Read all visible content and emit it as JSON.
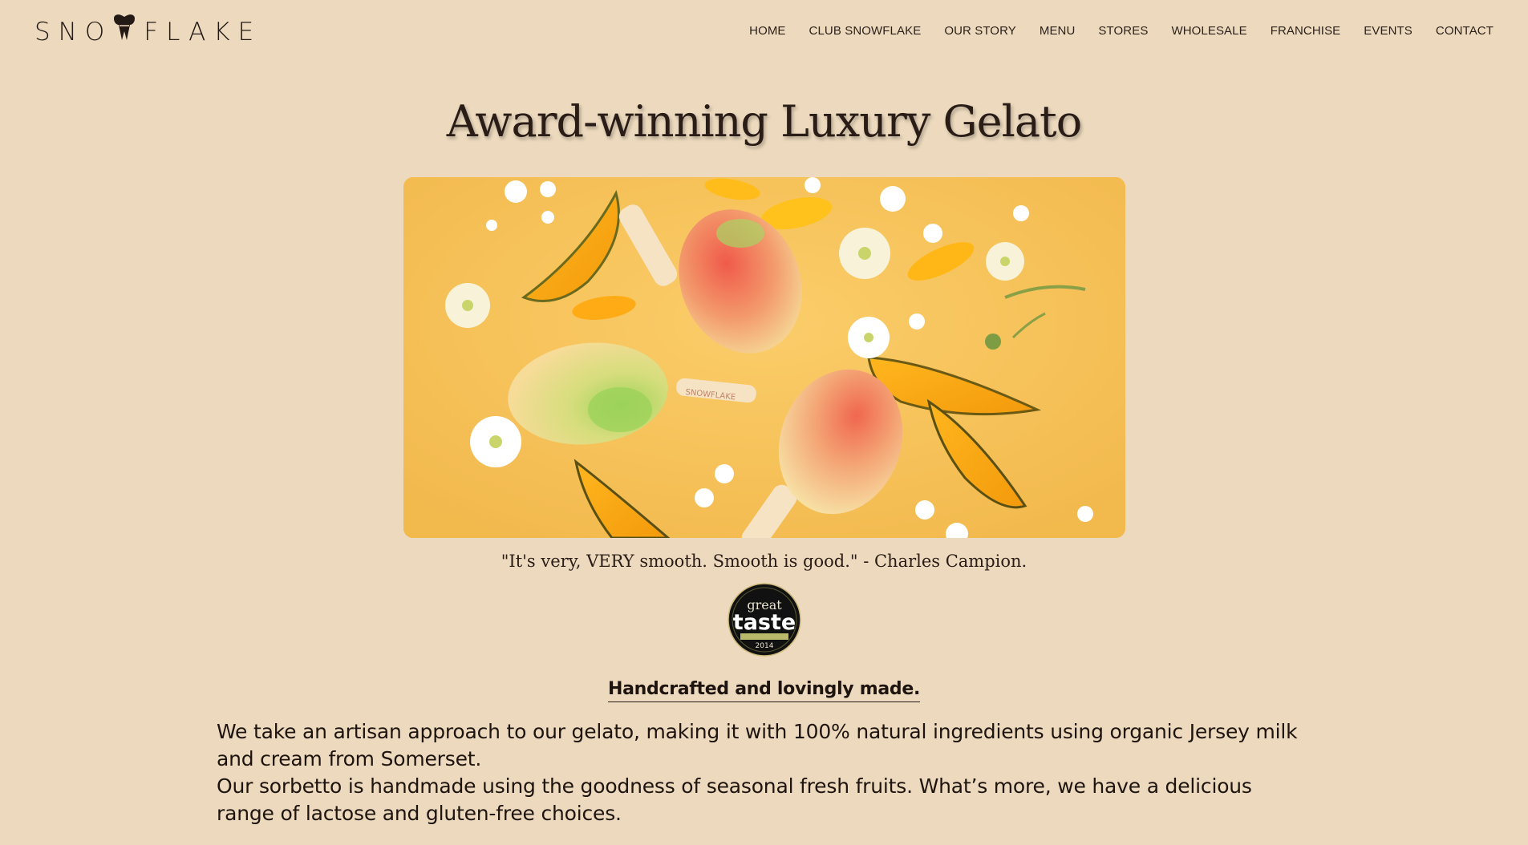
{
  "brand": {
    "name_left": "SNO",
    "name_right": "FLAKE"
  },
  "nav": {
    "items": [
      {
        "label": "HOME"
      },
      {
        "label": "CLUB SNOWFLAKE"
      },
      {
        "label": "OUR STORY"
      },
      {
        "label": "MENU"
      },
      {
        "label": "STORES"
      },
      {
        "label": "WHOLESALE"
      },
      {
        "label": "FRANCHISE"
      },
      {
        "label": "EVENTS"
      },
      {
        "label": "CONTACT"
      }
    ]
  },
  "hero": {
    "title": "Award-winning Luxury Gelato",
    "image_description": "mango-shaped gelato lollies with mango slices and flowers on yellow background",
    "stick_text": "SNOWFLAKE"
  },
  "quote": {
    "text": "\"It's very, VERY smooth. Smooth is good.\" - Charles Campion."
  },
  "award": {
    "line1": "great",
    "line2": "taste",
    "year": "2014",
    "heading": "Handcrafted and lovingly made."
  },
  "intro": {
    "paragraph1": "We take an artisan approach to our gelato, making it with 100% natural ingredients using organic Jersey milk and cream from Somerset.",
    "paragraph2": "Our sorbetto is handmade using the goodness of seasonal fresh fruits. What’s more, we have a delicious range of lactose and gluten-free choices."
  },
  "colors": {
    "background": "#eddabe",
    "text": "#1e140f",
    "hero_background": "#f5c35a"
  }
}
